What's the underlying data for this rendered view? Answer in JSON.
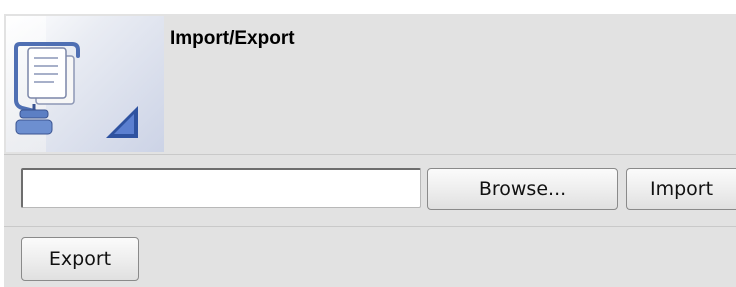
{
  "panel": {
    "title": "Import/Export",
    "icon": "import-export-icon"
  },
  "import": {
    "file_value": "",
    "browse_label": "Browse...",
    "import_label": "Import"
  },
  "export": {
    "export_label": "Export"
  },
  "colors": {
    "panel_background": "#e2e2e2",
    "icon_background": "#ccd3e6",
    "separator": "#c9c9c9"
  }
}
